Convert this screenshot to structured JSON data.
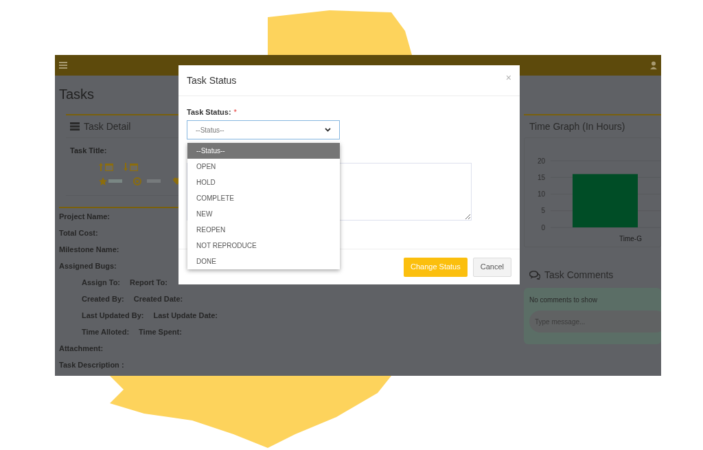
{
  "page_title": "Tasks",
  "task_detail": {
    "title": "Task Detail",
    "task_title_label": "Task Title:",
    "fields": [
      "Project Name:",
      "Total Cost:",
      "Milestone Name:",
      "Assigned Bugs:"
    ],
    "bug_fields": [
      [
        "Assign To:",
        "Report To:"
      ],
      [
        "Created By:",
        "Created Date:"
      ],
      [
        "Last Updated By:",
        "Last Update Date:"
      ],
      [
        "Time Alloted:",
        "Time Spent:"
      ]
    ],
    "more_fields": [
      "Attachment:",
      "Task Description :"
    ]
  },
  "time_graph": {
    "title": "Time Graph (In Hours)",
    "chart_data": {
      "type": "bar",
      "categories": [
        "Time-G"
      ],
      "values": [
        16
      ],
      "ylim": [
        0,
        20
      ],
      "grid": true,
      "yticks": [
        0,
        5,
        10,
        15,
        20
      ]
    }
  },
  "comments": {
    "title": "Task Comments",
    "empty_text": "No comments to show",
    "input_placeholder": "Type message..."
  },
  "modal": {
    "title": "Task Status",
    "close": "×",
    "field_label": "Task Status:",
    "required_mark": "*",
    "select_value": "--Status--",
    "options": [
      {
        "label": "--Status--",
        "selected": true
      },
      {
        "label": "OPEN",
        "selected": false
      },
      {
        "label": "HOLD",
        "selected": false
      },
      {
        "label": "COMPLETE",
        "selected": false
      },
      {
        "label": "NEW",
        "selected": false
      },
      {
        "label": "REOPEN",
        "selected": false
      },
      {
        "label": "NOT REPRODUCE",
        "selected": false
      },
      {
        "label": "DONE",
        "selected": false
      }
    ],
    "buttons": [
      {
        "label": "Change Status",
        "kind": "primary"
      },
      {
        "label": "Cancel",
        "kind": "secondary"
      }
    ]
  }
}
